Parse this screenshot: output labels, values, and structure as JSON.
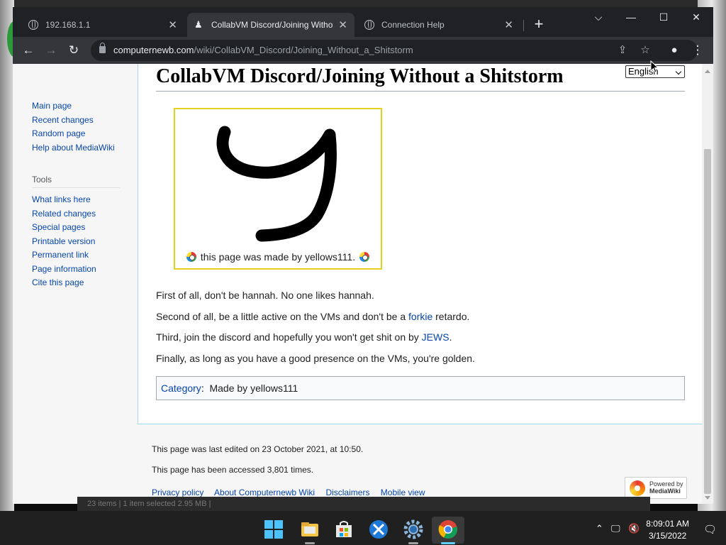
{
  "tabs": [
    {
      "title": "192.168.1.1",
      "icon": "globe-icon"
    },
    {
      "title": "CollabVM Discord/Joining Witho",
      "icon": "collabvm-icon"
    },
    {
      "title": "Connection Help",
      "icon": "globe-icon"
    }
  ],
  "address": {
    "host": "computernewb.com",
    "path": "/wiki/CollabVM_Discord/Joining_Without_a_Shitstorm"
  },
  "sidebar": {
    "nav": [
      "Main page",
      "Recent changes",
      "Random page",
      "Help about MediaWiki"
    ],
    "tools_heading": "Tools",
    "tools": [
      "What links here",
      "Related changes",
      "Special pages",
      "Printable version",
      "Permanent link",
      "Page information",
      "Cite this page"
    ]
  },
  "page": {
    "title": "CollabVM Discord/Joining Without a Shitstorm",
    "language": "English",
    "caption": "this page was made by yellows111.",
    "p1": "First of all, don't be hannah. No one likes hannah.",
    "p2_a": "Second of all, be a little active on the VMs and don't be a ",
    "p2_link": "forkie",
    "p2_b": " retardo.",
    "p3_a": "Third, join the discord and hopefully you won't get shit on by ",
    "p3_link": "JEWS",
    "p3_b": ".",
    "p4": "Finally, as long as you have a good presence on the VMs, you're golden.",
    "category_label": "Category",
    "category_value": "Made by yellows111"
  },
  "footer": {
    "last_edited": "This page was last edited on 23 October 2021, at 10:50.",
    "accessed": "This page has been accessed 3,801 times.",
    "links": [
      "Privacy policy",
      "About Computernewb Wiki",
      "Disclaimers",
      "Mobile view"
    ],
    "powered_line1": "Powered by",
    "powered_line2": "MediaWiki"
  },
  "explorer_status": "23 items  |  1 item selected  2.95 MB  |",
  "taskbar": {
    "time": "8:09:01 AM",
    "date": "3/15/2022"
  }
}
